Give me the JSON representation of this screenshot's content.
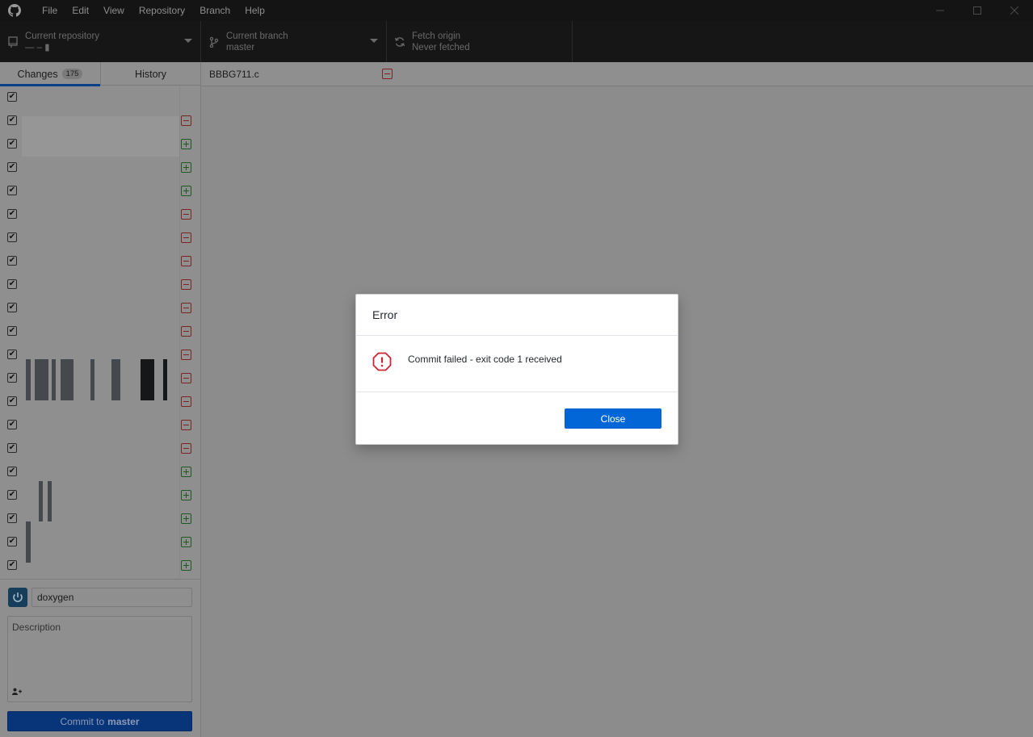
{
  "menu": [
    "File",
    "Edit",
    "View",
    "Repository",
    "Branch",
    "Help"
  ],
  "toolbar": {
    "repo_label": "Current repository",
    "repo_value": "— –  ▮",
    "branch_label": "Current branch",
    "branch_value": "master",
    "fetch_label": "Fetch origin",
    "fetch_value": "Never fetched"
  },
  "tabs": {
    "changes_label": "Changes",
    "changes_count": "175",
    "history_label": "History"
  },
  "file_rows": [
    {
      "status": "none"
    },
    {
      "status": "deleted"
    },
    {
      "status": "added"
    },
    {
      "status": "added"
    },
    {
      "status": "added"
    },
    {
      "status": "deleted"
    },
    {
      "status": "deleted"
    },
    {
      "status": "deleted"
    },
    {
      "status": "deleted"
    },
    {
      "status": "deleted"
    },
    {
      "status": "deleted"
    },
    {
      "status": "deleted"
    },
    {
      "status": "deleted"
    },
    {
      "status": "deleted"
    },
    {
      "status": "deleted"
    },
    {
      "status": "deleted"
    },
    {
      "status": "added"
    },
    {
      "status": "added"
    },
    {
      "status": "added"
    },
    {
      "status": "added"
    },
    {
      "status": "added"
    }
  ],
  "commit": {
    "summary_value": "doxygen",
    "description_placeholder": "Description",
    "button_prefix": "Commit to",
    "button_branch": "master"
  },
  "main": {
    "file_path": "BBBG711.c"
  },
  "dialog": {
    "title": "Error",
    "message": "Commit failed - exit code 1 received",
    "close_label": "Close"
  },
  "colors": {
    "accent": "#0366d6",
    "error": "#cb2431",
    "added": "#28a745",
    "deleted": "#cb2431"
  }
}
